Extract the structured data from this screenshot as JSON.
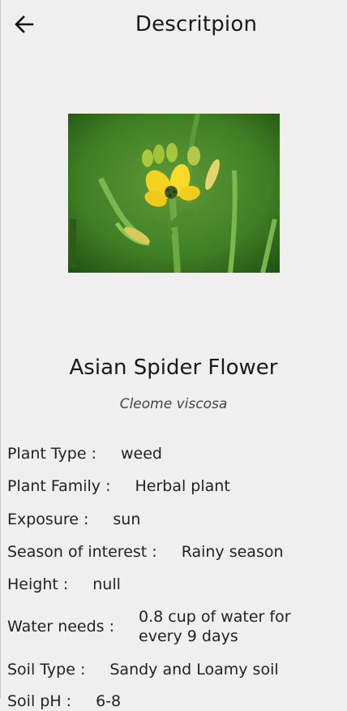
{
  "header": {
    "title": "Descritpion",
    "back_icon": "arrow-left-icon"
  },
  "plant": {
    "image_alt": "Asian Spider Flower photo",
    "common_name": "Asian Spider Flower",
    "scientific_name": "Cleome viscosa"
  },
  "details": [
    {
      "label": "Plant Type :",
      "value": "weed"
    },
    {
      "label": "Plant Family :",
      "value": "Herbal plant"
    },
    {
      "label": "Exposure :",
      "value": "sun"
    },
    {
      "label": "Season of interest :",
      "value": "Rainy season"
    },
    {
      "label": "Height :",
      "value": "null"
    },
    {
      "label": "Water needs :",
      "value": "0.8 cup of water for every 9 days"
    },
    {
      "label": "Soil Type :",
      "value": "Sandy and Loamy soil"
    },
    {
      "label": "Soil pH :",
      "value": "6-8"
    }
  ],
  "colors": {
    "background": "#efefef",
    "text": "#1a1a1a",
    "photo_green": "#3f7f24",
    "flower_yellow": "#f4d21f"
  }
}
